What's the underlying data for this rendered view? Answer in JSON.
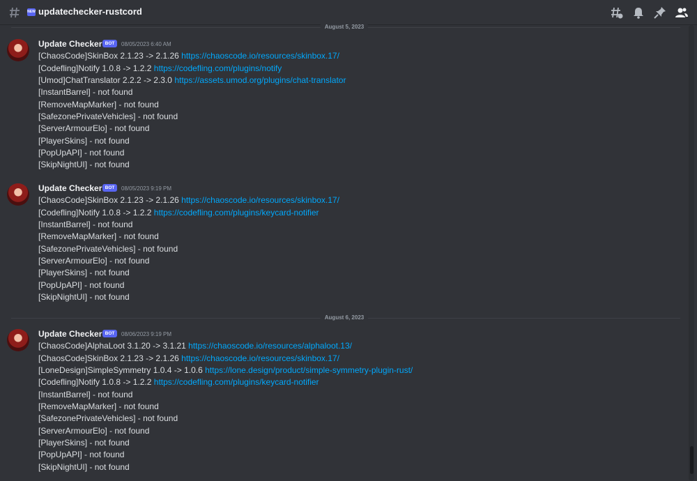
{
  "header": {
    "channel_name": "updatechecker-rustcord",
    "new_badge": "NEW",
    "icons": [
      "threads-icon",
      "bell-icon",
      "pin-icon",
      "members-icon"
    ]
  },
  "dividers": [
    "August 5, 2023",
    "August 6, 2023"
  ],
  "messages": [
    {
      "username": "Update Checker",
      "badge": "BOT",
      "timestamp": "08/05/2023 6:40 AM",
      "lines": [
        {
          "text": "[ChaosCode]SkinBox 2.1.23 -> 2.1.26 ",
          "link": "https://chaoscode.io/resources/skinbox.17/"
        },
        {
          "text": "[Codefling]Notify 1.0.8 -> 1.2.2 ",
          "link": "https://codefling.com/plugins/notify"
        },
        {
          "text": "[Umod]ChatTranslator 2.2.2 -> 2.3.0 ",
          "link": "https://assets.umod.org/plugins/chat-translator"
        },
        {
          "text": "[InstantBarrel] - not found",
          "link": ""
        },
        {
          "text": "[RemoveMapMarker] - not found",
          "link": ""
        },
        {
          "text": "[SafezonePrivateVehicles] - not found",
          "link": ""
        },
        {
          "text": "[ServerArmourElo] - not found",
          "link": ""
        },
        {
          "text": "[PlayerSkins] - not found",
          "link": ""
        },
        {
          "text": "[PopUpAPI] - not found",
          "link": ""
        },
        {
          "text": "[SkipNightUI] - not found",
          "link": ""
        }
      ]
    },
    {
      "username": "Update Checker",
      "badge": "BOT",
      "timestamp": "08/05/2023 9:19 PM",
      "lines": [
        {
          "text": "[ChaosCode]SkinBox 2.1.23 -> 2.1.26 ",
          "link": "https://chaoscode.io/resources/skinbox.17/"
        },
        {
          "text": "[Codefling]Notify 1.0.8 -> 1.2.2 ",
          "link": "https://codefling.com/plugins/keycard-notifier"
        },
        {
          "text": "[InstantBarrel] - not found",
          "link": ""
        },
        {
          "text": "[RemoveMapMarker] - not found",
          "link": ""
        },
        {
          "text": "[SafezonePrivateVehicles] - not found",
          "link": ""
        },
        {
          "text": "[ServerArmourElo] - not found",
          "link": ""
        },
        {
          "text": "[PlayerSkins] - not found",
          "link": ""
        },
        {
          "text": "[PopUpAPI] - not found",
          "link": ""
        },
        {
          "text": "[SkipNightUI] - not found",
          "link": ""
        }
      ]
    },
    {
      "username": "Update Checker",
      "badge": "BOT",
      "timestamp": "08/06/2023 9:19 PM",
      "lines": [
        {
          "text": "[ChaosCode]AlphaLoot 3.1.20 -> 3.1.21 ",
          "link": "https://chaoscode.io/resources/alphaloot.13/"
        },
        {
          "text": "[ChaosCode]SkinBox 2.1.23 -> 2.1.26 ",
          "link": "https://chaoscode.io/resources/skinbox.17/"
        },
        {
          "text": "[LoneDesign]SimpleSymmetry 1.0.4 -> 1.0.6 ",
          "link": "https://lone.design/product/simple-symmetry-plugin-rust/"
        },
        {
          "text": "[Codefling]Notify 1.0.8 -> 1.2.2 ",
          "link": "https://codefling.com/plugins/keycard-notifier"
        },
        {
          "text": "[InstantBarrel] - not found",
          "link": ""
        },
        {
          "text": "[RemoveMapMarker] - not found",
          "link": ""
        },
        {
          "text": "[SafezonePrivateVehicles] - not found",
          "link": ""
        },
        {
          "text": "[ServerArmourElo] - not found",
          "link": ""
        },
        {
          "text": "[PlayerSkins] - not found",
          "link": ""
        },
        {
          "text": "[PopUpAPI] - not found",
          "link": ""
        },
        {
          "text": "[SkipNightUI] - not found",
          "link": ""
        }
      ]
    }
  ]
}
